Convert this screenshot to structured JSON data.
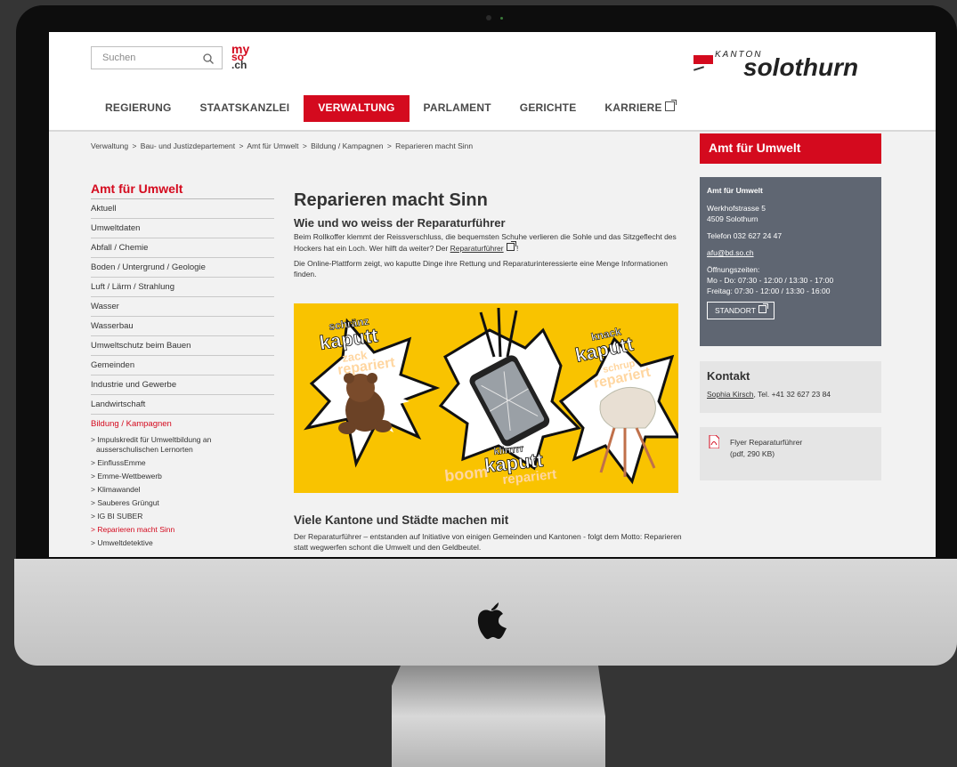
{
  "search": {
    "placeholder": "Suchen"
  },
  "logo_myso": {
    "line1": "my",
    "line2": "so",
    "line3": ".ch"
  },
  "brand": {
    "kanton": "KANTON",
    "name": "solothurn"
  },
  "nav": [
    {
      "label": "REGIERUNG",
      "active": false
    },
    {
      "label": "STAATSKANZLEI",
      "active": false
    },
    {
      "label": "VERWALTUNG",
      "active": true
    },
    {
      "label": "PARLAMENT",
      "active": false
    },
    {
      "label": "GERICHTE",
      "active": false
    },
    {
      "label": "KARRIERE",
      "active": false,
      "external": true
    }
  ],
  "breadcrumb": [
    "Verwaltung",
    "Bau- und Justizdepartement",
    "Amt für Umwelt",
    "Bildung / Kampagnen",
    "Reparieren macht Sinn"
  ],
  "breadcrumb_sep": ">",
  "sidebar": {
    "title": "Amt für Umwelt",
    "items": [
      "Aktuell",
      "Umweltdaten",
      "Abfall / Chemie",
      "Boden / Untergrund / Geologie",
      "Luft / Lärm / Strahlung",
      "Wasser",
      "Wasserbau",
      "Umweltschutz beim Bauen",
      "Gemeinden",
      "Industrie und Gewerbe",
      "Landwirtschaft"
    ],
    "active_item": "Bildung / Kampagnen",
    "subitems": [
      {
        "label": "> Impulskredit für Umweltbildung an",
        "active": false
      },
      {
        "label": "ausserschulischen Lernorten",
        "active": false
      },
      {
        "label": "> EinflussEmme",
        "active": false
      },
      {
        "label": "> Emme-Wettbewerb",
        "active": false
      },
      {
        "label": "> Klimawandel",
        "active": false
      },
      {
        "label": "> Sauberes Grüngut",
        "active": false
      },
      {
        "label": "> IG BI SUBER",
        "active": false
      },
      {
        "label": "> Reparieren macht Sinn",
        "active": true
      },
      {
        "label": "> Umweltdetektive",
        "active": false
      }
    ]
  },
  "main": {
    "title": "Reparieren macht Sinn",
    "subtitle": "Wie und wo weiss der Reparaturführer",
    "p1_a": "Beim Rollkoffer klemmt der Reissverschluss, die bequemsten Schuhe verlieren die Sohle und das Sitzgeflecht des Hockers hat ein Loch. Wer hilft da weiter? Der ",
    "p1_link": "Reparaturführer",
    "p1_b": " !",
    "p2": "Die Online-Plattform zeigt, wo kaputte Dinge ihre Rettung und Reparaturinteressierte eine Menge Informationen finden.",
    "hero": {
      "t1a": "schränz",
      "t1b": "kaputt",
      "t1c": "zack",
      "t1d": "repariert",
      "t2a": "knack",
      "t2b": "kaputt",
      "t2c": "schrup",
      "t2d": "repariert",
      "t3a": "klirrrrr",
      "t3b": "kaputt",
      "t3c": "boom",
      "t3d": "repariert"
    },
    "heading2": "Viele Kantone und Städte machen mit",
    "p3": "Der Reparaturführer – entstanden auf Initiative von einigen Gemeinden und Kantonen - folgt dem Motto: Reparieren statt wegwerfen schont die Umwelt und den Geldbeutel."
  },
  "right": {
    "header": "Amt für Umwelt",
    "info_title": "Amt für Umwelt",
    "street": "Werkhofstrasse 5",
    "city": "4509 Solothurn",
    "phone": "Telefon 032 627 24 47",
    "email": "afu@bd.so.ch",
    "hours_label": "Öffnungszeiten:",
    "hours1": "Mo - Do: 07:30 - 12:00 / 13:30 - 17:00",
    "hours2": "Freitag: 07:30 - 12:00 / 13:30 - 16:00",
    "standort": "STANDORT",
    "kontakt_title": "Kontakt",
    "kontakt_name": "Sophia Kirsch",
    "kontakt_tel": ", Tel. +41 32 627 23 84",
    "flyer_line1": "Flyer Reparaturführer",
    "flyer_line2": "(pdf, 290 KB)"
  },
  "colors": {
    "brand_red": "#d40a1e",
    "info_box": "#5f6672",
    "hero_yellow": "#f9c300"
  }
}
